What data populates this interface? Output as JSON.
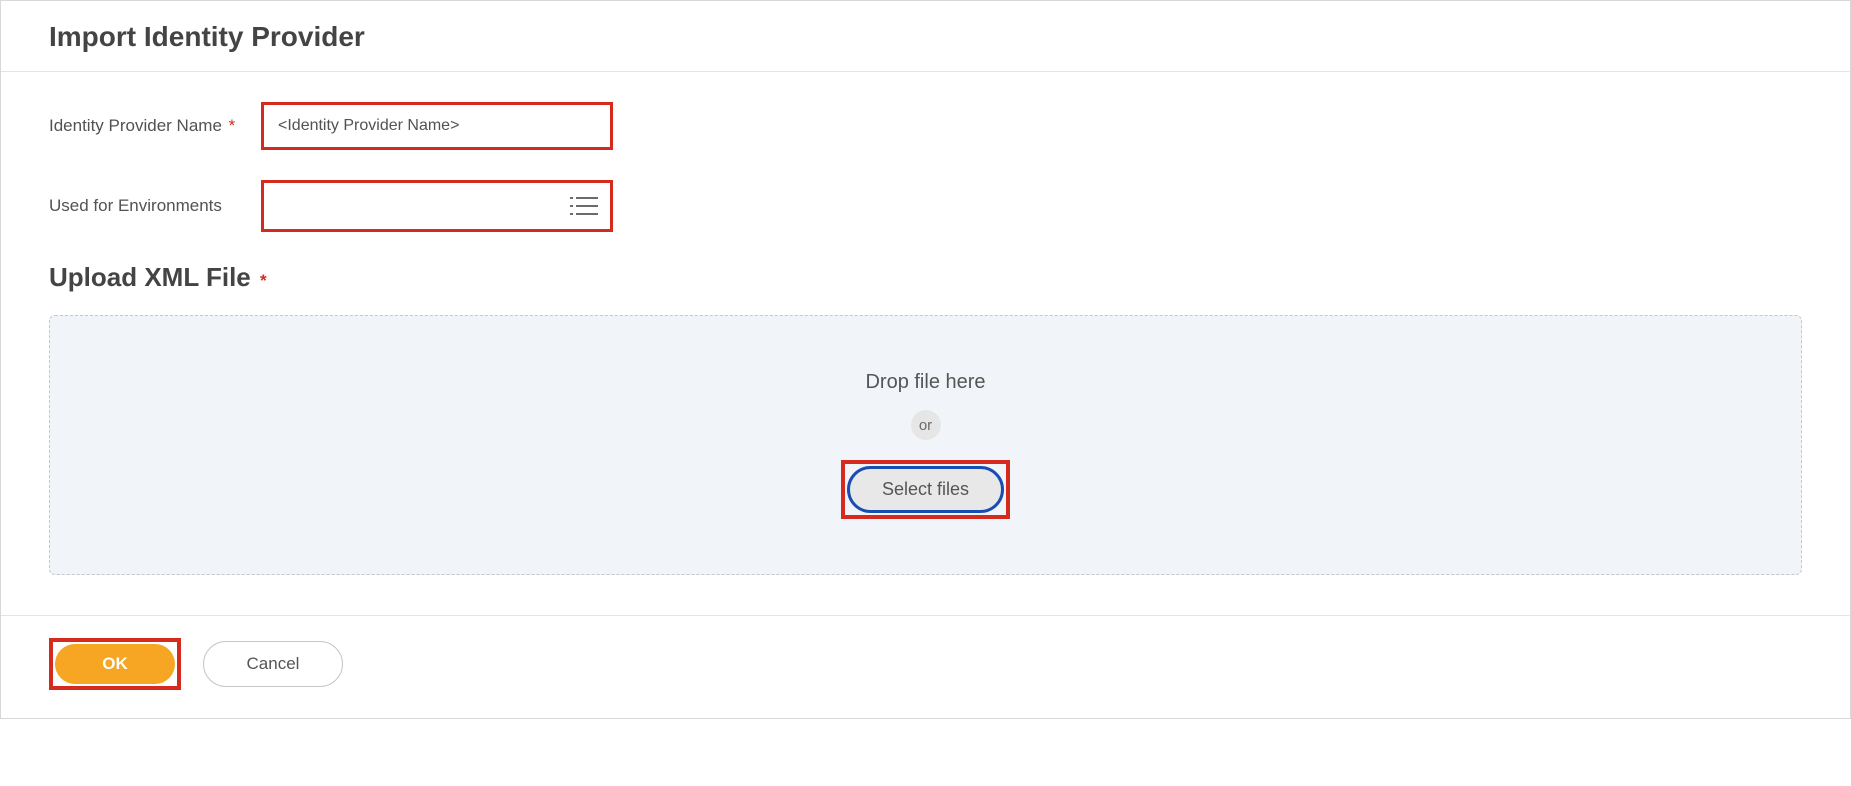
{
  "header": {
    "title": "Import Identity Provider"
  },
  "form": {
    "name_label": "Identity Provider Name",
    "name_value": "<Identity Provider Name>",
    "env_label": "Used for Environments",
    "env_value": ""
  },
  "upload": {
    "heading": "Upload XML File",
    "drop_text": "Drop file here",
    "or_text": "or",
    "select_files": "Select files"
  },
  "footer": {
    "ok": "OK",
    "cancel": "Cancel"
  }
}
